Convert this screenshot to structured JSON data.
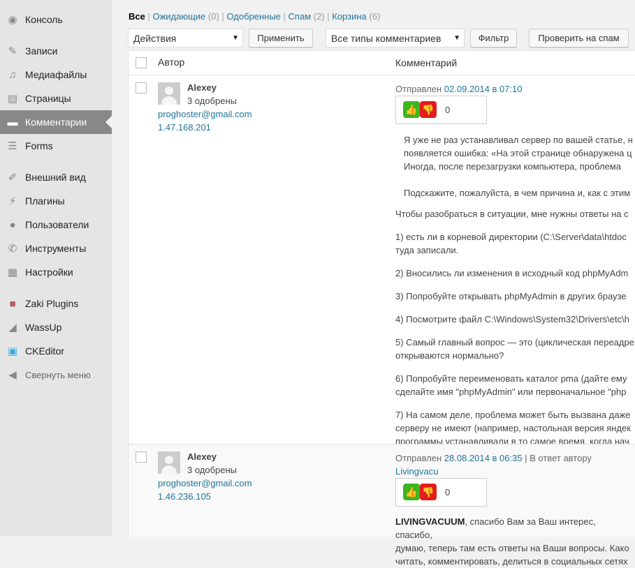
{
  "sidebar": {
    "items": [
      {
        "label": "Консоль",
        "icon": "dashboard-icon"
      },
      {
        "label": "Записи",
        "icon": "pin-icon"
      },
      {
        "label": "Медиафайлы",
        "icon": "media-icon"
      },
      {
        "label": "Страницы",
        "icon": "pages-icon"
      },
      {
        "label": "Комментарии",
        "icon": "comment-icon",
        "active": true
      },
      {
        "label": "Forms",
        "icon": "forms-icon"
      },
      {
        "label": "Внешний вид",
        "icon": "brush-icon"
      },
      {
        "label": "Плагины",
        "icon": "plugin-icon"
      },
      {
        "label": "Пользователи",
        "icon": "user-icon"
      },
      {
        "label": "Инструменты",
        "icon": "wrench-icon"
      },
      {
        "label": "Настройки",
        "icon": "settings-icon"
      },
      {
        "label": "Zaki Plugins",
        "icon": "zaki-icon"
      },
      {
        "label": "WassUp",
        "icon": "chart-icon"
      },
      {
        "label": "CKEditor",
        "icon": "ckeditor-icon"
      }
    ],
    "collapse": "Свернуть меню"
  },
  "filters": {
    "all": "Все",
    "pending": "Ожидающие",
    "pending_count": "(0)",
    "approved": "Одобренные",
    "spam": "Спам",
    "spam_count": "(2)",
    "trash": "Корзина",
    "trash_count": "(6)"
  },
  "toolbar": {
    "actions": "Действия",
    "apply": "Применить",
    "types": "Все типы комментариев",
    "filter": "Фильтр",
    "check_spam": "Проверить на спам"
  },
  "table": {
    "col_author": "Автор",
    "col_comment": "Комментарий"
  },
  "comments": [
    {
      "author": "Alexey",
      "approved": "3 одобрены",
      "email": "proghoster@gmail.com",
      "ip": "1.47.168.201",
      "sent": "Отправлен",
      "date": "02.09.2014 в 07:10",
      "votes": "0",
      "quote": [
        "Я уже не раз устанавливал сервер по вашей статье, н",
        "появляется ошибка: «На этой странице обнаружена ц",
        "Иногда, после перезагрузки компьютера, проблема",
        "",
        "Подскажите, пожалуйста, в чем причина и, как с этим"
      ],
      "body": [
        "Чтобы разобраться в ситуации, мне нужны ответы на с",
        "1) есть ли в корневой директории (C:\\Server\\data\\htdoc\nтуда записали.",
        "2) Вносились ли изменения в исходный код phpMyAdm",
        "3) Попробуйте открывать phpMyAdmin в других браузе",
        "4) Посмотрите файл C:\\Windows\\System32\\Drivers\\etc\\h",
        "5) Самый главный вопрос — это (циклическая переадре\nоткрываются нормально?",
        "6) Попробуйте переименовать каталог pma (дайте ему\nсделайте имя \"phpMyAdmin\" или первоначальное \"php",
        "7) На самом деле, проблема может быть вызвана даже\nсерверу не имеют (например, настольная версия яндек\nпрограммы устанавливали в то самое время, когда нач"
      ]
    },
    {
      "author": "Alexey",
      "approved": "3 одобрены",
      "email": "proghoster@gmail.com",
      "ip": "1.46.236.105",
      "sent": "Отправлен",
      "date": "28.08.2014 в 06:35",
      "reply_prefix": "| В ответ автору",
      "reply_to": "Livingvacu",
      "votes": "0",
      "mention": "LIVINGVACUUM",
      "body": [
        ", спасибо Вам за Ваш интерес, спасибо,",
        "думаю, теперь там есть ответы на Ваши вопросы. Како",
        "читать, комментировать, делиться в социальных сетях"
      ]
    }
  ]
}
